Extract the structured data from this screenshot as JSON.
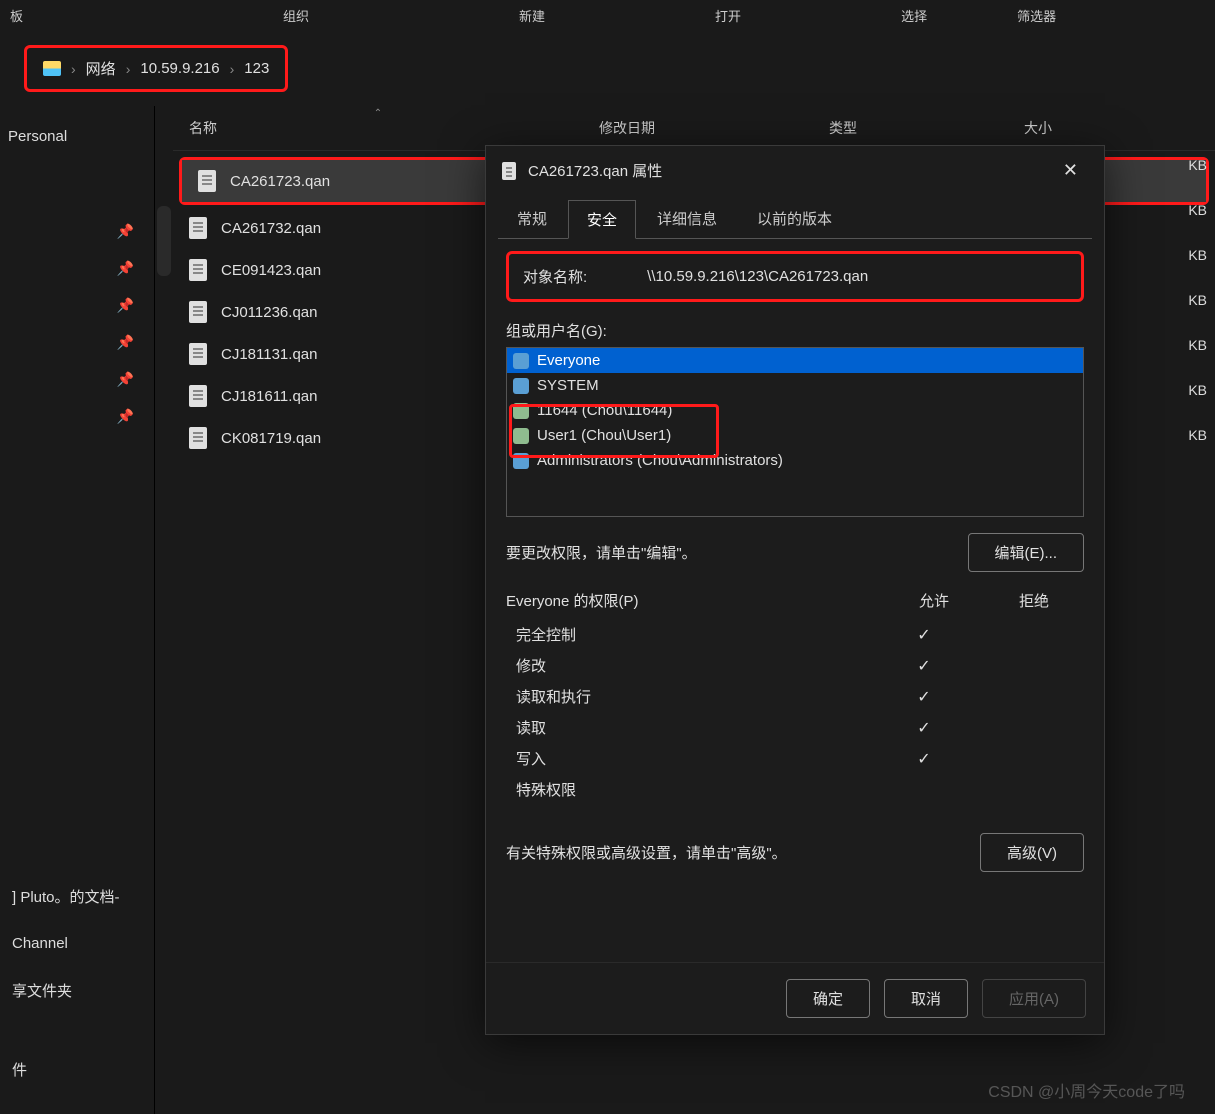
{
  "topMenu": [
    "板",
    "组织",
    "新建",
    "打开",
    "选择",
    "筛选器"
  ],
  "breadcrumb": {
    "items": [
      "网络",
      "10.59.9.216",
      "123"
    ]
  },
  "columns": {
    "name": "名称",
    "date": "修改日期",
    "type": "类型",
    "size": "大小"
  },
  "files": [
    {
      "name": "CA261723.qan",
      "selected": true,
      "highlighted": true,
      "size": "KB"
    },
    {
      "name": "CA261732.qan",
      "size": "KB"
    },
    {
      "name": "CE091423.qan",
      "size": "KB"
    },
    {
      "name": "CJ011236.qan",
      "size": "KB"
    },
    {
      "name": "CJ181131.qan",
      "size": "KB"
    },
    {
      "name": "CJ181611.qan",
      "size": "KB"
    },
    {
      "name": "CK081719.qan",
      "size": "KB"
    }
  ],
  "sidebar": {
    "personal": "Personal",
    "bottom": [
      "] Pluto。的文档-",
      "Channel",
      "享文件夹",
      "件"
    ]
  },
  "dialog": {
    "title": "CA261723.qan 属性",
    "tabs": [
      "常规",
      "安全",
      "详细信息",
      "以前的版本"
    ],
    "activeTab": 1,
    "objectLabel": "对象名称:",
    "objectValue": "\\\\10.59.9.216\\123\\CA261723.qan",
    "groupLabel": "组或用户名(G):",
    "users": [
      {
        "name": "Everyone",
        "iconClass": "multi",
        "selected": true
      },
      {
        "name": "SYSTEM",
        "iconClass": "multi"
      },
      {
        "name": "11644 (Chou\\11644)",
        "iconClass": "single",
        "highlighted": true
      },
      {
        "name": "User1 (Chou\\User1)",
        "iconClass": "single",
        "highlighted": true
      },
      {
        "name": "Administrators (Chou\\Administrators)",
        "iconClass": "multi"
      }
    ],
    "editText": "要更改权限，请单击\"编辑\"。",
    "editBtn": "编辑(E)...",
    "permHeader": {
      "name": "Everyone 的权限(P)",
      "allow": "允许",
      "deny": "拒绝"
    },
    "perms": [
      {
        "name": "完全控制",
        "allow": true
      },
      {
        "name": "修改",
        "allow": true
      },
      {
        "name": "读取和执行",
        "allow": true
      },
      {
        "name": "读取",
        "allow": true
      },
      {
        "name": "写入",
        "allow": true
      },
      {
        "name": "特殊权限"
      }
    ],
    "advText": "有关特殊权限或高级设置，请单击\"高级\"。",
    "advBtn": "高级(V)",
    "buttons": {
      "ok": "确定",
      "cancel": "取消",
      "apply": "应用(A)"
    }
  },
  "watermark": "CSDN @小周今天code了吗"
}
